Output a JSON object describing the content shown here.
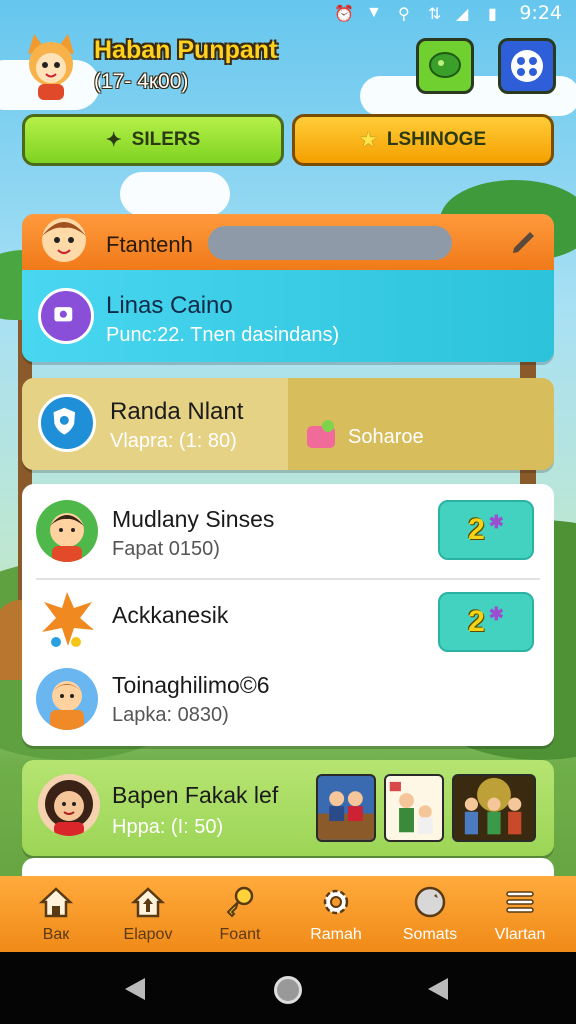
{
  "status_bar": {
    "time": "9:24"
  },
  "header": {
    "title": "Haban Punpant",
    "subtitle": "(17- 4к00)"
  },
  "top_buttons": {
    "left_label": "SILERS",
    "right_label": "LSHINOGE"
  },
  "card_profile": {
    "bar_title": "Ftantenh",
    "title": "Linas Caino",
    "subtitle": "Punc:22. Tnen dasindans)"
  },
  "card_randa": {
    "title": "Randa Nlant",
    "subtitle": "Vlapra: (1: 80)",
    "right_label": "Soharoe"
  },
  "list": {
    "items": [
      {
        "name": "Mudlany Sinses",
        "sub": "Fapat 0150)",
        "badge": "2"
      },
      {
        "name": "Ackkanesik",
        "sub": "",
        "badge": "2"
      },
      {
        "name": "Toinaghilimo©6",
        "sub": "Lapka: 0830)"
      }
    ]
  },
  "card_bapen": {
    "title": "Bapen Fakak lef",
    "subtitle": "Hppa: (I: 50)"
  },
  "tabs": [
    {
      "label": "Baк"
    },
    {
      "label": "Elapov"
    },
    {
      "label": "Foant"
    },
    {
      "label": "Ramah"
    },
    {
      "label": "Somats"
    },
    {
      "label": "Vlartan"
    }
  ],
  "colors": {
    "tab_bar": "#f59a2a",
    "accent_green": "#7ed321",
    "accent_orange": "#f5a000",
    "teal_badge": "#44d2c0"
  },
  "icons": {
    "tabs": [
      "home-icon",
      "house-arrow-icon",
      "key-icon",
      "gear-icon",
      "wrench-icon",
      "menu-icon"
    ]
  }
}
